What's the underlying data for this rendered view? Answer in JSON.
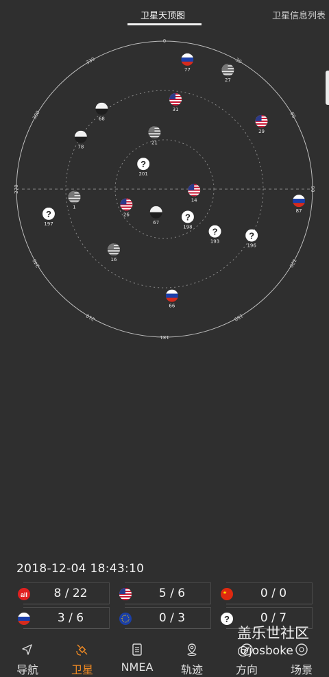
{
  "tabs": [
    {
      "label": "卫星天顶图",
      "active": true
    },
    {
      "label": "卫星信息列表",
      "active": false
    }
  ],
  "sky": {
    "bearing_labels": [
      "0",
      "30",
      "60",
      "90",
      "120",
      "150",
      "181",
      "210",
      "240",
      "270",
      "300",
      "330"
    ],
    "satellites": [
      {
        "id": "77",
        "flag": "ru",
        "az": 10,
        "el": 10
      },
      {
        "id": "27",
        "flag": "us-bw",
        "az": 28,
        "el": 8
      },
      {
        "id": "68",
        "flag": "gray",
        "az": 322,
        "el": 28
      },
      {
        "id": "31",
        "flag": "us",
        "az": 7,
        "el": 35
      },
      {
        "id": "29",
        "flag": "us",
        "az": 55,
        "el": 18
      },
      {
        "id": "78",
        "flag": "gray",
        "az": 302,
        "el": 30
      },
      {
        "id": "21",
        "flag": "us-bw",
        "az": 350,
        "el": 55
      },
      {
        "id": "201",
        "flag": "q",
        "az": 320,
        "el": 70
      },
      {
        "id": "26",
        "flag": "us",
        "az": 248,
        "el": 65
      },
      {
        "id": "14",
        "flag": "us",
        "az": 92,
        "el": 72
      },
      {
        "id": "87",
        "flag": "ru",
        "az": 95,
        "el": 8
      },
      {
        "id": "1",
        "flag": "us-bw",
        "az": 265,
        "el": 35
      },
      {
        "id": "197",
        "flag": "q",
        "az": 258,
        "el": 18
      },
      {
        "id": "67",
        "flag": "gray",
        "az": 200,
        "el": 75
      },
      {
        "id": "198",
        "flag": "q",
        "az": 140,
        "el": 68
      },
      {
        "id": "193",
        "flag": "q",
        "az": 130,
        "el": 50
      },
      {
        "id": "196",
        "flag": "q",
        "az": 118,
        "el": 30
      },
      {
        "id": "16",
        "flag": "us-bw",
        "az": 220,
        "el": 42
      },
      {
        "id": "66",
        "flag": "ru",
        "az": 176,
        "el": 25
      }
    ]
  },
  "timestamp": "2018-12-04  18:43:10",
  "stats": [
    {
      "icon": "all",
      "value": "8 / 22"
    },
    {
      "icon": "us",
      "value": "5 / 6"
    },
    {
      "icon": "cn",
      "value": "0 / 0"
    },
    {
      "icon": "ru",
      "value": "3 / 6"
    },
    {
      "icon": "eu",
      "value": "0 / 3"
    },
    {
      "icon": "q",
      "value": "0 / 7"
    }
  ],
  "nav": [
    {
      "label": "导航",
      "icon": "navigation-arrow-icon",
      "active": false
    },
    {
      "label": "卫星",
      "icon": "satellite-icon",
      "active": true
    },
    {
      "label": "NMEA",
      "icon": "document-icon",
      "active": false
    },
    {
      "label": "轨迹",
      "icon": "location-pin-icon",
      "active": false
    },
    {
      "label": "方向",
      "icon": "compass-icon",
      "active": false
    },
    {
      "label": "场景",
      "icon": "scene-icon",
      "active": false
    }
  ],
  "watermark": {
    "line1": "盖乐世社区",
    "line2": "@josboke"
  },
  "colors": {
    "accent": "#f08a24",
    "background": "#2f2f2f"
  }
}
